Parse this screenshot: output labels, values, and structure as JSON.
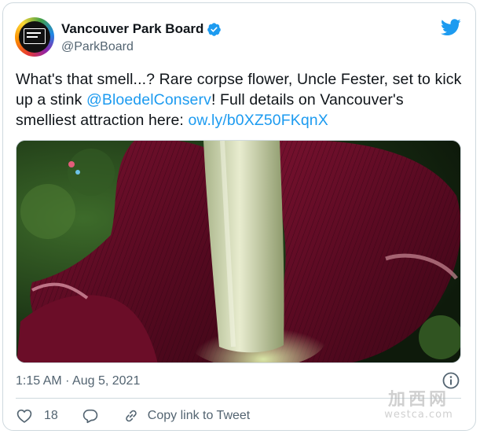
{
  "profile": {
    "display_name": "Vancouver Park Board",
    "handle": "@ParkBoard",
    "verified": true,
    "avatar_icon": "vancouver-park-board-logo",
    "avatar_colors": [
      "#e53935",
      "#fb8c00",
      "#fdd835",
      "#43a047",
      "#1e88e5",
      "#8e24aa"
    ]
  },
  "header": {
    "platform_icon": "twitter-bird-icon",
    "brand_color": "#1d9bf0"
  },
  "tweet": {
    "text_part1": "What's that smell...? Rare corpse flower, Uncle Fester, set to kick up a stink ",
    "mention": "@BloedelConserv",
    "text_part2": "! Full details on Vancouver's smelliest attraction here:  ",
    "url": "ow.ly/b0XZ50FKqnX",
    "link_color": "#1d9bf0",
    "media_description_icon": "corpse-flower-photo"
  },
  "meta": {
    "timestamp": "1:15 AM · Aug 5, 2021",
    "info_icon": "info-icon"
  },
  "actions": {
    "like_count": "18",
    "like_icon": "heart-icon",
    "reply_icon": "reply-bubble-icon",
    "copy_icon": "link-icon",
    "copy_label": "Copy link to Tweet"
  },
  "watermark": {
    "cn": "加西网",
    "en": "westca.com"
  }
}
